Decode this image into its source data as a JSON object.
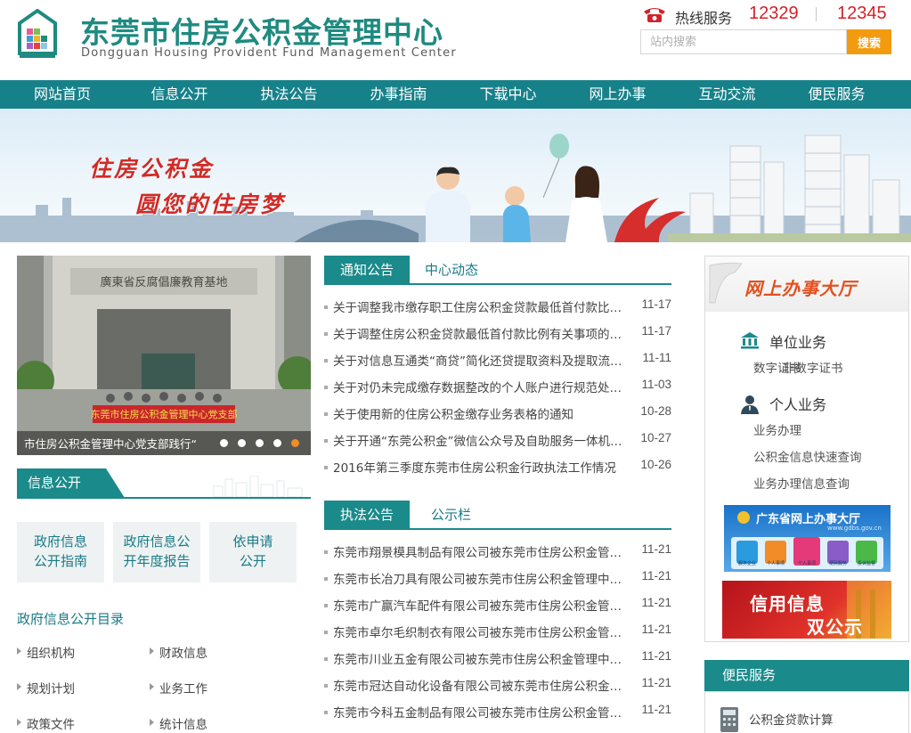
{
  "header": {
    "title": "东莞市住房公积金管理中心",
    "subtitle": "Dongguan Housing Provident Fund Management Center",
    "hotline_label": "热线服务",
    "hotline_numbers": [
      "12329",
      "12345"
    ],
    "search_placeholder": "站内搜索",
    "search_button": "搜索"
  },
  "nav": [
    "网站首页",
    "信息公开",
    "执法公告",
    "办事指南",
    "下载中心",
    "网上办事",
    "互动交流",
    "便民服务"
  ],
  "banner": {
    "slogan_line1": "住房公积金",
    "slogan_line2": "圆您的住房梦"
  },
  "slideshow": {
    "caption": "市住房公积金管理中心党支部践行“",
    "total": 5,
    "active_index": 4
  },
  "info_public": {
    "tab": "信息公开",
    "boxes": [
      [
        "政府信息",
        "公开指南"
      ],
      [
        "政府信息公",
        "开年度报告"
      ],
      [
        "依申请",
        "公开"
      ]
    ],
    "catalog_title": "政府信息公开目录",
    "catalog_items": [
      "组织机构",
      "财政信息",
      "规划计划",
      "业务工作",
      "政策文件",
      "统计信息"
    ]
  },
  "notices": {
    "tab_active": "通知公告",
    "tab_other": "中心动态",
    "items": [
      {
        "title": "关于调整我市缴存职工住房公积金贷款最低首付款比例的通知",
        "date": "11-17"
      },
      {
        "title": "关于调整住房公积金贷款最低首付款比例有关事项的说明",
        "date": "11-17"
      },
      {
        "title": "关于对信息互通类“商贷”简化还贷提取资料及提取流程的通知",
        "date": "11-11"
      },
      {
        "title": "关于对仍未完成缴存数据整改的个人账户进行规范处理的通知",
        "date": "11-03"
      },
      {
        "title": "关于使用新的住房公积金缴存业务表格的通知",
        "date": "10-28"
      },
      {
        "title": "关于开通“东莞公积金”微信公众号及自助服务一体机的公告",
        "date": "10-27"
      },
      {
        "title": "2016年第三季度东莞市住房公积金行政执法工作情况",
        "date": "10-26"
      }
    ]
  },
  "enforcement": {
    "tab_active": "执法公告",
    "tab_other": "公示栏",
    "items": [
      {
        "title": "东莞市翔景模具制品有限公司被东莞市住房公积金管理中心",
        "date": "11-21"
      },
      {
        "title": "东莞市长冶刀具有限公司被东莞市住房公积金管理中心处罚",
        "date": "11-21"
      },
      {
        "title": "东莞市广赢汽车配件有限公司被东莞市住房公积金管理中心",
        "date": "11-21"
      },
      {
        "title": "东莞市卓尔毛织制衣有限公司被东莞市住房公积金管理中心",
        "date": "11-21"
      },
      {
        "title": "东莞市川业五金有限公司被东莞市住房公积金管理中心处罚",
        "date": "11-21"
      },
      {
        "title": "东莞市冠达自动化设备有限公司被东莞市住房公积金管理中心",
        "date": "11-21"
      },
      {
        "title": "东莞市今科五金制品有限公司被东莞市住房公积金管理中心",
        "date": "11-21"
      }
    ]
  },
  "online_hall": {
    "title": "网上办事大厅",
    "unit_title": "单位业务",
    "unit_links": [
      "数字证书",
      "非数字证书"
    ],
    "personal_title": "个人业务",
    "personal_links": [
      "业务办理",
      "公积金信息快速查询",
      "业务办理信息查询"
    ],
    "gd_banner_title": "广东省网上办事大厅",
    "gd_banner_url": "www.gdbs.gov.cn",
    "gd_banner_items": [
      "服务企业",
      "个人事项",
      "个人事项",
      "便民服务",
      "投诉监督"
    ],
    "credit_line1": "信用信息",
    "credit_line2": "双公示"
  },
  "convenience": {
    "tab": "便民服务",
    "items": [
      "公积金贷款计算"
    ]
  },
  "colors": {
    "primary": "#17818a",
    "accent_orange": "#f29b0f",
    "hotline_red": "#d3222a"
  }
}
